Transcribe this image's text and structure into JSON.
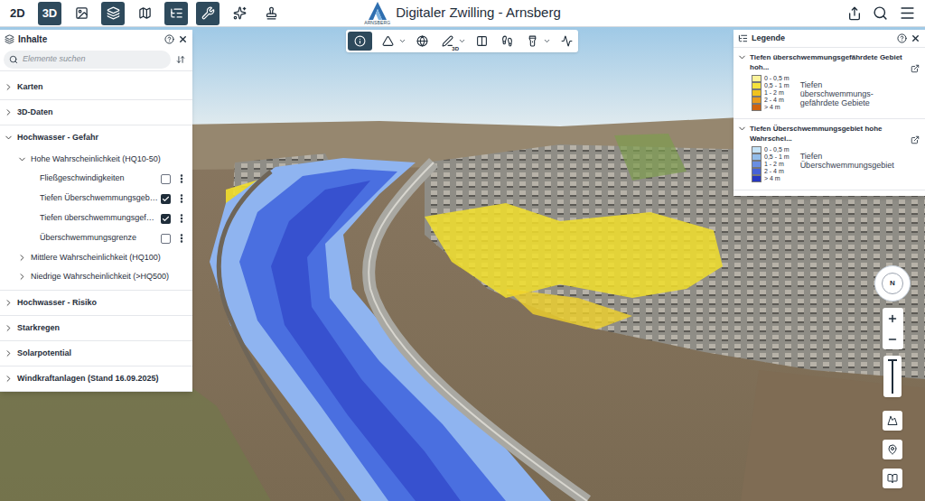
{
  "app": {
    "title": "Digitaler Zwilling - Arnsberg",
    "logo_text": "ARNSBERG"
  },
  "topbar": {
    "view_modes": [
      {
        "label": "2D",
        "selected": false
      },
      {
        "label": "3D",
        "selected": true
      }
    ],
    "tools": [
      {
        "selected": false
      },
      {
        "selected": true
      },
      {
        "selected": false
      },
      {
        "selected": true
      },
      {
        "selected": true
      },
      {
        "selected": false
      },
      {
        "selected": false
      }
    ]
  },
  "map_toolbar": {
    "tools": [
      {
        "selected": true,
        "dropdown": false
      },
      {
        "selected": false,
        "dropdown": true
      },
      {
        "selected": false,
        "dropdown": false
      },
      {
        "selected": false,
        "dropdown": true,
        "badge": "3D"
      },
      {
        "selected": false,
        "dropdown": false
      },
      {
        "selected": false,
        "dropdown": false
      },
      {
        "selected": false,
        "dropdown": true
      },
      {
        "selected": false,
        "dropdown": false
      }
    ]
  },
  "contents": {
    "title": "Inhalte",
    "search_placeholder": "Elemente suchen",
    "items": [
      {
        "label": "Karten",
        "expanded": false,
        "children": []
      },
      {
        "label": "3D-Daten",
        "expanded": false,
        "children": []
      },
      {
        "label": "Hochwasser - Gefahr",
        "expanded": true,
        "children": [
          {
            "label": "Hohe Wahrscheinlichkeit (HQ10-50)",
            "expanded": true,
            "layers": [
              {
                "label": "Fließgeschwindigkeiten",
                "checked": false
              },
              {
                "label": "Tiefen Überschwemmungsgeb…",
                "checked": true
              },
              {
                "label": "Tiefen überschwemmungsgef…",
                "checked": true
              },
              {
                "label": "Überschwemmungsgrenze",
                "checked": false
              }
            ]
          },
          {
            "label": "Mittlere Wahrscheinlichkeit (HQ100)",
            "expanded": false,
            "layers": []
          },
          {
            "label": "Niedrige Wahrscheinlichkeit (>HQ500)",
            "expanded": false,
            "layers": []
          }
        ]
      },
      {
        "label": "Hochwasser - Risiko",
        "expanded": false,
        "children": []
      },
      {
        "label": "Starkregen",
        "expanded": false,
        "children": []
      },
      {
        "label": "Solarpotential",
        "expanded": false,
        "children": []
      },
      {
        "label": "Windkraftanlagen (Stand 16.09.2025)",
        "expanded": false,
        "children": []
      }
    ]
  },
  "legend": {
    "title": "Legende",
    "sections": [
      {
        "title": "Tiefen überschwemmungsgefährdete Gebiet hoh...",
        "expanded": true,
        "label_lines": [
          "Tiefen",
          "überschwemmungs-",
          "gefährdete Gebiete"
        ],
        "entries": [
          {
            "label": "0 - 0,5 m",
            "color": "#fbf39a"
          },
          {
            "label": "0,5 - 1 m",
            "color": "#f5e23c"
          },
          {
            "label": "1 - 2 m",
            "color": "#f0c21e"
          },
          {
            "label": "2 - 4 m",
            "color": "#e89a1c"
          },
          {
            "label": "> 4 m",
            "color": "#d0620e"
          }
        ]
      },
      {
        "title": "Tiefen Überschwemmungsgebiet hohe Wahrschei...",
        "expanded": true,
        "label_lines": [
          "Tiefen",
          "Überschwemmungsgebiet"
        ],
        "entries": [
          {
            "label": "0 - 0,5 m",
            "color": "#c4e2f6"
          },
          {
            "label": "0,5 - 1 m",
            "color": "#93bdea"
          },
          {
            "label": "1 - 2 m",
            "color": "#6a8ee2"
          },
          {
            "label": "2 - 4 m",
            "color": "#4762d6"
          },
          {
            "label": "> 4 m",
            "color": "#2637c2"
          }
        ]
      }
    ]
  },
  "compass": {
    "label": "N"
  }
}
